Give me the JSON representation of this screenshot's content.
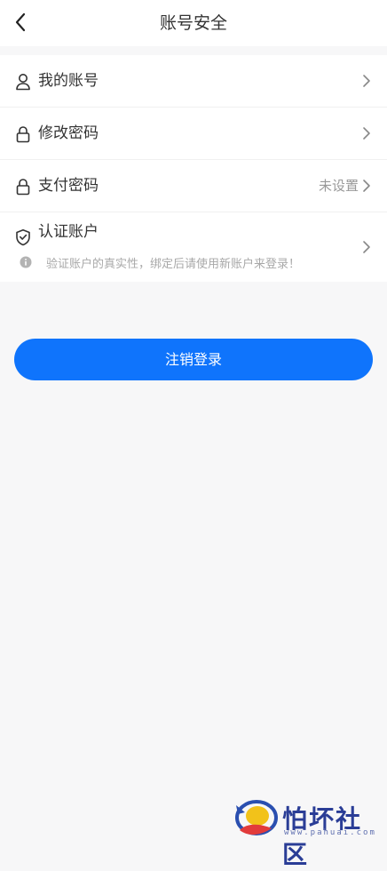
{
  "header": {
    "title": "账号安全",
    "back_icon": "chevron-left-icon"
  },
  "menu": [
    {
      "label": "我的账号",
      "icon": "user-icon",
      "value": ""
    },
    {
      "label": "修改密码",
      "icon": "lock-icon",
      "value": ""
    },
    {
      "label": "支付密码",
      "icon": "lock-icon",
      "value": "未设置"
    },
    {
      "label": "认证账户",
      "icon": "shield-check-icon",
      "value": "",
      "hint": "验证账户的真实性，绑定后请使用新账户来登录！"
    }
  ],
  "logout_button": {
    "label": "注销登录",
    "color": "#0f74fc"
  },
  "watermark": {
    "text": "怕坏社区",
    "url": "www.pahuai.com"
  },
  "colors": {
    "background": "#f7f7f8",
    "card": "#ffffff",
    "text": "#333333",
    "muted": "#999999",
    "accent": "#0f74fc"
  }
}
